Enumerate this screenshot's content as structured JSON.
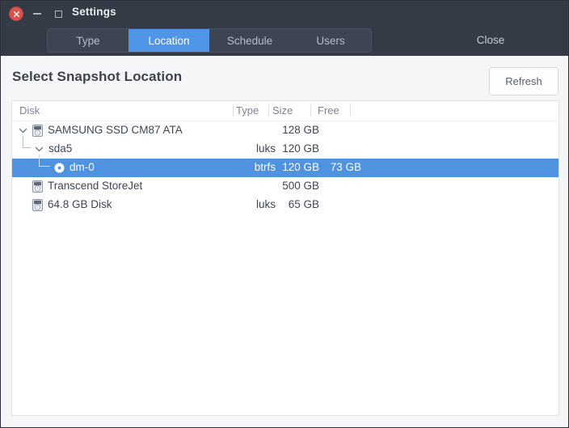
{
  "window": {
    "title": "Settings",
    "controls": {
      "close": "close-icon",
      "minimize": "minimize-icon",
      "maximize": "maximize-icon"
    },
    "close_button_label": "Close"
  },
  "tabs": [
    {
      "label": "Type",
      "active": false
    },
    {
      "label": "Location",
      "active": true
    },
    {
      "label": "Schedule",
      "active": false
    },
    {
      "label": "Users",
      "active": false
    }
  ],
  "main": {
    "heading": "Select Snapshot Location",
    "refresh_label": "Refresh"
  },
  "table": {
    "columns": [
      "Disk",
      "Type",
      "Size",
      "Free"
    ],
    "rows": [
      {
        "disk": "SAMSUNG SSD CM87 ATA",
        "type": "",
        "size": "128 GB",
        "free": "",
        "depth": 0,
        "icon": "hdd-icon",
        "expander": "chevron-down-icon",
        "selected": false
      },
      {
        "disk": "sda5",
        "type": "luks",
        "size": "120 GB",
        "free": "",
        "depth": 1,
        "icon": "none",
        "expander": "chevron-down-icon",
        "selected": false
      },
      {
        "disk": "dm-0",
        "type": "btrfs",
        "size": "120 GB",
        "free": "73 GB",
        "depth": 2,
        "icon": "disc-icon",
        "expander": "none",
        "selected": true
      },
      {
        "disk": "Transcend StoreJet",
        "type": "",
        "size": "500 GB",
        "free": "",
        "depth": 0,
        "icon": "hdd-icon",
        "expander": "none",
        "selected": false
      },
      {
        "disk": "64.8 GB Disk",
        "type": "luks",
        "size": "65 GB",
        "free": "",
        "depth": 0,
        "icon": "hdd-icon",
        "expander": "none",
        "selected": false
      }
    ]
  },
  "colors": {
    "titlebar_bg": "#343a46",
    "accent": "#4f92e0",
    "tab_active_bg": "#4f96e8",
    "close_button_red": "#d9534f",
    "panel_bg": "#f5f6f8",
    "list_bg": "#ffffff"
  }
}
